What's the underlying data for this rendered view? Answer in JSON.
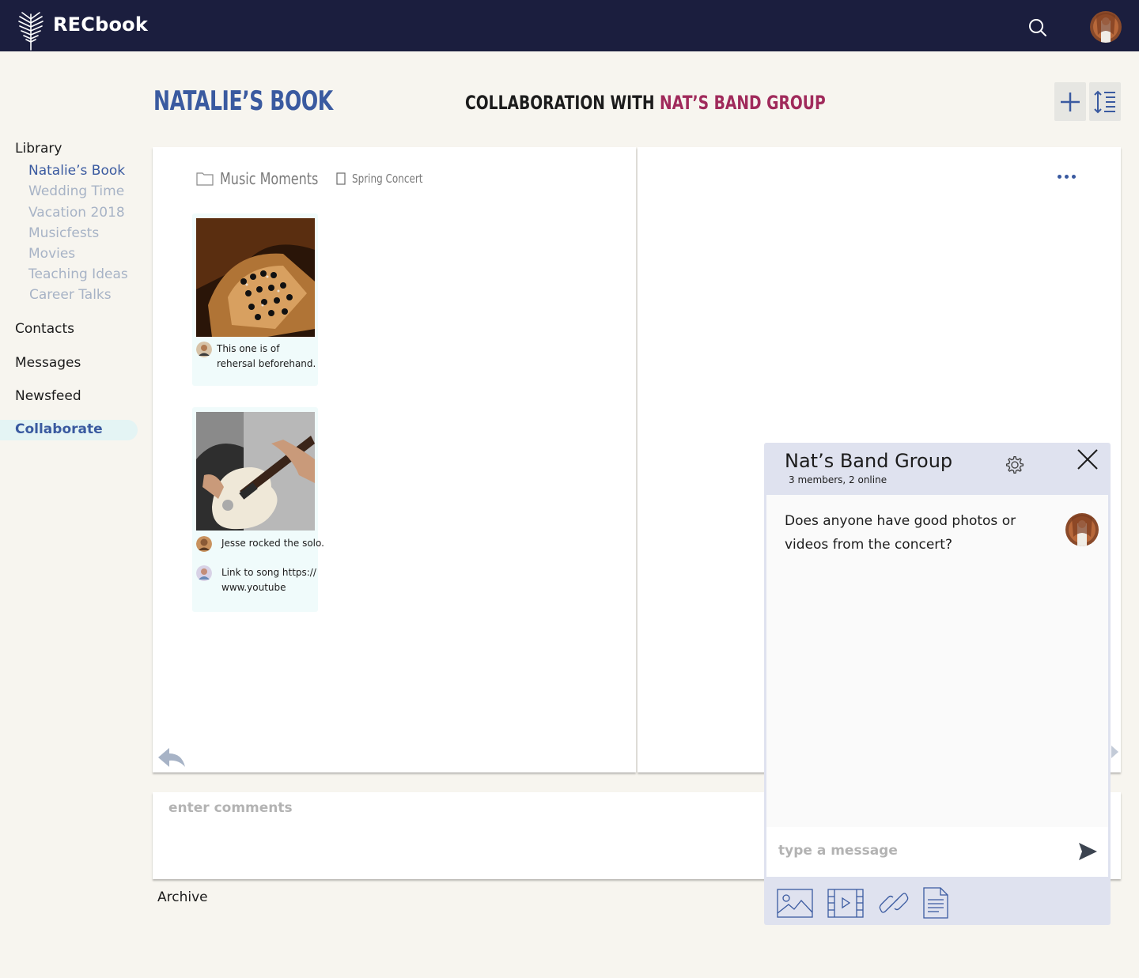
{
  "app": {
    "name": "RECbook"
  },
  "header": {
    "book_title": "NATALIE’S BOOK",
    "collab_prefix": "COLLABORATION WITH ",
    "collab_group": "NAT’S BAND GROUP"
  },
  "sidebar": {
    "library": "Library",
    "books": [
      "Natalie’s Book",
      "Wedding Time",
      "Vacation 2018",
      "Musicfests",
      "Movies",
      "Teaching Ideas",
      "Career Talks"
    ],
    "contacts": "Contacts",
    "messages": "Messages",
    "newsfeed": "Newsfeed",
    "collaborate": "Collaborate"
  },
  "page": {
    "folder": "Music Moments",
    "subfolder": "Spring Concert",
    "cards": [
      {
        "comments": [
          "This one is of rehersal beforehand."
        ]
      },
      {
        "comments": [
          "Jesse rocked the solo.",
          "Link to song https://www.youtube"
        ]
      }
    ]
  },
  "comments": {
    "placeholder": "enter comments"
  },
  "footer": {
    "archive": "Archive"
  },
  "chat": {
    "title": "Nat’s Band Group",
    "subtitle": "3 members, 2 online",
    "message": "Does anyone have good photos or videos from the concert?",
    "input_placeholder": "type a message"
  },
  "colors": {
    "navy": "#1b1e3e",
    "accent_blue": "#3a5aa0",
    "accent_magenta": "#a02a5b",
    "chat_bg": "#dfe2ef"
  }
}
